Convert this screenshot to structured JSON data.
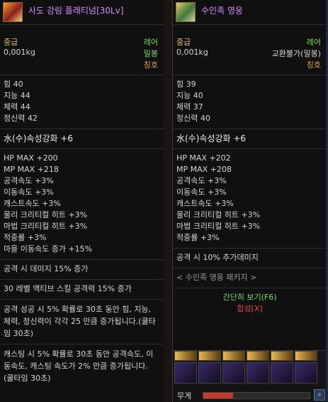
{
  "left": {
    "title": "사도 강림 플래티넘[30Lv]",
    "grade": "중급",
    "rarity": "레어",
    "weight": "0,001kg",
    "bind": "밀봉",
    "type": "칭호",
    "stats": [
      "힘 40",
      "지능 44",
      "체력 44",
      "정신력 42"
    ],
    "element": "水(수)속성강화 +6",
    "bonuses": [
      "HP MAX +200",
      "MP MAX +218",
      "공격속도 +3%",
      "이동속도 +3%",
      "캐스트속도 +3%",
      "물리 크리티컬 히트 +3%",
      "마법 크리티컬 히트 +3%",
      "적중률 +3%",
      "마을 이동속도 증가 +15%"
    ],
    "effect1": "공격 시 데미지 15% 증가",
    "effect2": "30 레벨 액티브 스킬 공격력 15% 증가",
    "effect3": "공격 성공 시 5% 확률로 30초 동안 힘, 지능, 체력, 정신력이 각각 25 만큼 증가됩니다.(쿨타임 30초)",
    "effect4": "캐스팅 시 5% 확률로 30초 동안 공격속도, 이동속도, 캐스팅 속도가 2% 만큼 증가됩니다.(쿨타임 30초)"
  },
  "right": {
    "title": "수인족 영웅",
    "grade": "중급",
    "rarity": "레어",
    "weight": "0,001kg",
    "bind": "교환불가(밀봉)",
    "type": "칭호",
    "stats": [
      "힘 39",
      "지능 40",
      "체력 37",
      "정신력 40"
    ],
    "element": "水(수)속성강화 +6",
    "bonuses": [
      "HP MAX +202",
      "MP MAX +208",
      "공격속도 +3%",
      "이동속도 +3%",
      "캐스트속도 +3%",
      "물리 크리티컬 히트 +3%",
      "마법 크리티컬 히트 +3%",
      "적중률 +3%"
    ],
    "effect1": "공격 시 10% 추가데미지",
    "package": "< 수인족 영웅 패키지 >",
    "simple_view": "간단히 보기(F6)",
    "synthesis": "합성[X]",
    "weight_label": "무게",
    "search_icon": "⌕"
  },
  "colors": {
    "title": "#d38fff",
    "gold": "#e0c060",
    "green": "#7ddb62",
    "red": "#e04848"
  }
}
